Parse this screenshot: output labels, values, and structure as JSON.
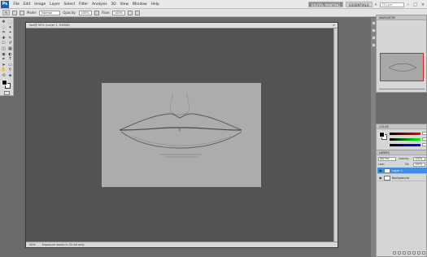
{
  "app": {
    "logo": "Ps",
    "menu": [
      "File",
      "Edit",
      "Image",
      "Layer",
      "Select",
      "Filter",
      "Analysis",
      "3D",
      "View",
      "Window",
      "Help"
    ],
    "workspaces": [
      "DIGITAL PAINTING",
      "ESSENTIALS"
    ],
    "more_workspaces": "»",
    "cs_live": "CS Live",
    "window_controls": [
      "–",
      "□",
      "×"
    ]
  },
  "options": {
    "tool_glyph": "✎",
    "mode_label": "Mode:",
    "mode_value": "Normal",
    "opacity_label": "Opacity:",
    "opacity_value": "100%",
    "flow_label": "Flow:",
    "flow_value": "100%"
  },
  "toolbox": {
    "tools": [
      "move-tool",
      "marquee-tool",
      "lasso-tool",
      "quick-select-tool",
      "crop-tool",
      "eyedropper-tool",
      "healing-tool",
      "brush-tool",
      "clone-stamp-tool",
      "history-brush-tool",
      "eraser-tool",
      "gradient-tool",
      "blur-tool",
      "dodge-tool",
      "pen-tool",
      "type-tool",
      "path-select-tool",
      "shape-tool",
      "hand-tool",
      "zoom-tool",
      "rotate-view-tool",
      "3d-tool"
    ],
    "glyphs": [
      "✥",
      "⬚",
      "◌",
      "✦",
      "⌗",
      "⌖",
      "✚",
      "✎",
      "⎔",
      "↺",
      "◫",
      "▦",
      "◉",
      "◐",
      "✒",
      "T",
      "➤",
      "▭",
      "✋",
      "⚲",
      "⟲",
      "◈"
    ],
    "foreground_color": "#000000",
    "background_color": "#ffffff"
  },
  "document": {
    "title": "lips@ 50% (Layer 1, RGB/8)",
    "zoom": "50%",
    "doc_info": "Exposure works in 32-bit only",
    "close": "×"
  },
  "panels": {
    "navigator_tab": "NAVIGATOR",
    "color_tab": "COLOR",
    "layers_tab": "LAYERS",
    "blend_mode": "Normal",
    "opacity_label": "Opacity:",
    "opacity_value": "100%",
    "lock_label": "Lock:",
    "fill_label": "Fill:",
    "fill_value": "100%",
    "layers": [
      {
        "name": "Layer 1",
        "selected": true
      },
      {
        "name": "Background",
        "selected": false
      }
    ]
  },
  "colors": {
    "app_bg": "#6a6a6a",
    "doc_bg": "#535353",
    "canvas": "#acacac",
    "selection": "#3f8fe0"
  }
}
